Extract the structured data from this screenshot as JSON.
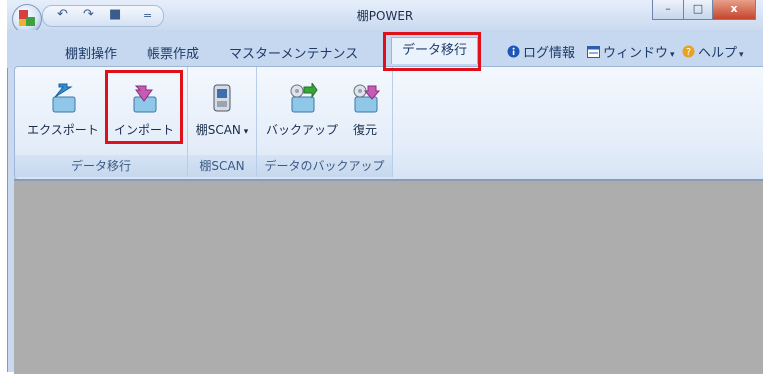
{
  "window": {
    "title": "棚POWER",
    "controls": {
      "minimize": "–",
      "maximize": "□",
      "close": "x"
    }
  },
  "quick_access": {
    "undo": "↶",
    "redo": "↷",
    "save": "■",
    "more": "="
  },
  "tabs": [
    {
      "label": "棚割操作"
    },
    {
      "label": "帳票作成"
    },
    {
      "label": "マスターメンテナンス"
    },
    {
      "label": "データ移行"
    }
  ],
  "right_menu": {
    "log": "ログ情報",
    "window": "ウィンドウ",
    "help": "ヘルプ"
  },
  "ribbon": {
    "groups": [
      {
        "title": "データ移行",
        "buttons": [
          {
            "label": "エクスポート"
          },
          {
            "label": "インポート"
          }
        ]
      },
      {
        "title": "棚SCAN",
        "buttons": [
          {
            "label": "棚SCAN"
          }
        ]
      },
      {
        "title": "データのバックアップ",
        "buttons": [
          {
            "label": "バックアップ"
          },
          {
            "label": "復元"
          }
        ]
      }
    ]
  },
  "colors": {
    "highlight": "#e0101a",
    "accent": "#1e3a66"
  }
}
